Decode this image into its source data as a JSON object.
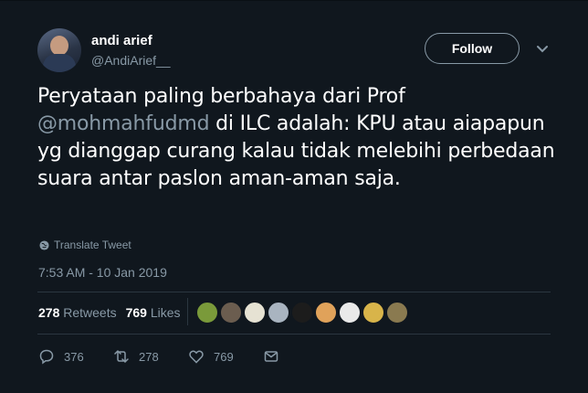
{
  "user": {
    "name": "andi arief",
    "handle": "@AndiArief__"
  },
  "follow_label": "Follow",
  "tweet": {
    "part1": "Peryataan paling berbahaya dari Prof ",
    "mention": "@mohmahfudmd",
    "part2": " di ILC adalah: KPU atau aiapapun yg dianggap curang kalau tidak melebihi perbedaan suara antar paslon aman-aman saja."
  },
  "translate_label": "Translate Tweet",
  "timestamp": "7:53 AM - 10 Jan 2019",
  "stats": {
    "retweets_count": "278",
    "retweets_label": "Retweets",
    "likes_count": "769",
    "likes_label": "Likes"
  },
  "likers": [
    {
      "color": "#7a9a3a"
    },
    {
      "color": "#6b5d4f"
    },
    {
      "color": "#e6e2d3"
    },
    {
      "color": "#a9b4c0"
    },
    {
      "color": "#1c1c1c"
    },
    {
      "color": "#e0a25a"
    },
    {
      "color": "#e9e9e9"
    },
    {
      "color": "#d8b44a"
    },
    {
      "color": "#8a7a50"
    }
  ],
  "actions": {
    "reply_count": "376",
    "retweet_count": "278",
    "like_count": "769"
  },
  "colors": {
    "background": "#10171e",
    "muted": "#8899a6",
    "divider": "#2b3640"
  }
}
